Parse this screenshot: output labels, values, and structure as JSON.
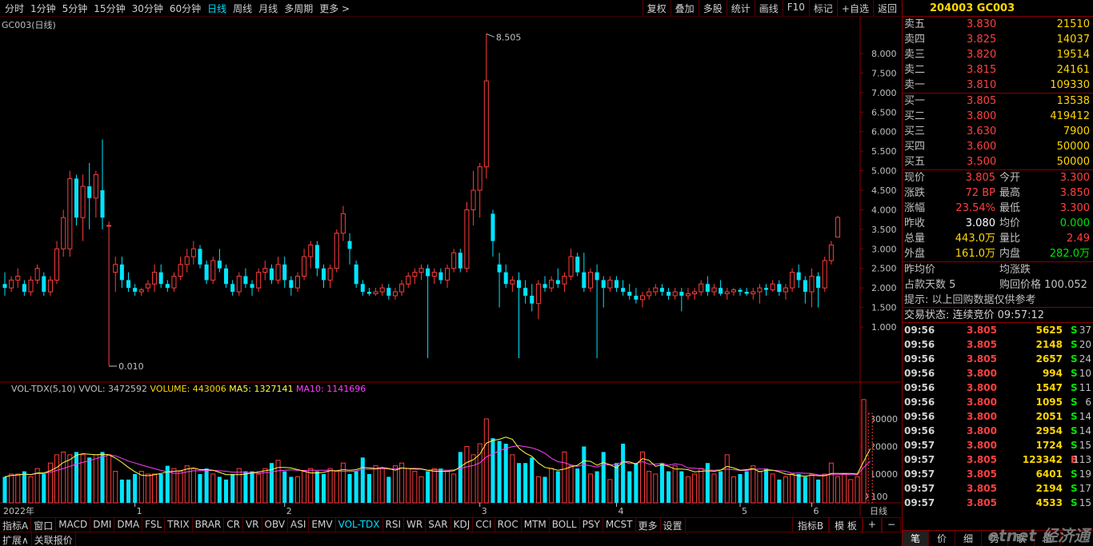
{
  "topbar": {
    "periods": [
      "分时",
      "1分钟",
      "5分钟",
      "15分钟",
      "30分钟",
      "60分钟",
      "日线",
      "周线",
      "月线",
      "多周期",
      "更多 >"
    ],
    "active_period": "日线",
    "tools": [
      "复权",
      "叠加",
      "多股",
      "统计",
      "画线",
      "F10",
      "标记",
      "+自选",
      "返回"
    ]
  },
  "main_pane": {
    "title": "GC003(日线)",
    "y_ticks": [
      "8.000",
      "7.500",
      "7.000",
      "6.500",
      "6.000",
      "5.500",
      "5.000",
      "4.500",
      "4.000",
      "3.500",
      "3.000",
      "2.500",
      "2.000",
      "1.500",
      "1.000"
    ],
    "high_label": "8.505",
    "low_label": "0.010"
  },
  "vol_pane": {
    "legend_name": "VOL-TDX(5,10)",
    "legend_vvol": "VVOL: 3472592",
    "legend_volume": "VOLUME: 443006",
    "legend_ma5": "MA5: 1327141",
    "legend_ma10": "MA10: 1141696",
    "y_ticks": [
      "30000",
      "20000",
      "10000"
    ],
    "unit": "X100"
  },
  "x_axis": {
    "labels": [
      "2022年",
      "1",
      "2",
      "3",
      "4",
      "5",
      "6"
    ],
    "right_label": "日线"
  },
  "indicator_bar": {
    "items": [
      "指标A",
      "窗口",
      "MACD",
      "DMI",
      "DMA",
      "FSL",
      "TRIX",
      "BRAR",
      "CR",
      "VR",
      "OBV",
      "ASI",
      "EMV",
      "VOL-TDX",
      "RSI",
      "WR",
      "SAR",
      "KDJ",
      "CCI",
      "ROC",
      "MTM",
      "BOLL",
      "PSY",
      "MCST",
      "更多",
      "设置"
    ],
    "active": "VOL-TDX",
    "right_items": [
      "指标B",
      "模 板",
      "+",
      "−"
    ]
  },
  "bottom_bar": {
    "items": [
      "扩展∧",
      "关联报价"
    ]
  },
  "quote_panel": {
    "title": "204003 GC003",
    "sells": [
      {
        "label": "卖五",
        "price": "3.830",
        "vol": "21510"
      },
      {
        "label": "卖四",
        "price": "3.825",
        "vol": "14037"
      },
      {
        "label": "卖三",
        "price": "3.820",
        "vol": "19514"
      },
      {
        "label": "卖二",
        "price": "3.815",
        "vol": "24161"
      },
      {
        "label": "卖一",
        "price": "3.810",
        "vol": "109330"
      }
    ],
    "buys": [
      {
        "label": "买一",
        "price": "3.805",
        "vol": "13538"
      },
      {
        "label": "买二",
        "price": "3.800",
        "vol": "419412"
      },
      {
        "label": "买三",
        "price": "3.630",
        "vol": "7900"
      },
      {
        "label": "买四",
        "price": "3.600",
        "vol": "50000"
      },
      {
        "label": "买五",
        "price": "3.500",
        "vol": "50000"
      }
    ],
    "stats": [
      {
        "l1": "现价",
        "v1": "3.805",
        "c1": "red",
        "l2": "今开",
        "v2": "3.300",
        "c2": "red"
      },
      {
        "l1": "涨跌",
        "v1": "72 BP",
        "c1": "red",
        "l2": "最高",
        "v2": "3.850",
        "c2": "red"
      },
      {
        "l1": "涨幅",
        "v1": "23.54%",
        "c1": "red",
        "l2": "最低",
        "v2": "3.300",
        "c2": "red"
      },
      {
        "l1": "昨收",
        "v1": "3.080",
        "c1": "white",
        "l2": "均价",
        "v2": "0.000",
        "c2": "green"
      },
      {
        "l1": "总量",
        "v1": "443.0万",
        "c1": "yellow",
        "l2": "量比",
        "v2": "2.49",
        "c2": "red"
      },
      {
        "l1": "外盘",
        "v1": "161.0万",
        "c1": "yellow",
        "l2": "内盘",
        "v2": "282.0万",
        "c2": "green"
      }
    ],
    "info": {
      "prev_avg_label": "昨均价",
      "avg_change_label": "均涨跌",
      "days_label": "占款天数 5",
      "repo_label": "购回价格 100.052",
      "hint": "提示: 以上回购数据仅供参考",
      "status": "交易状态: 连续竞价 09:57:12"
    },
    "ticks": [
      {
        "t": "09:56",
        "p": "3.805",
        "v": "5625",
        "s": "S",
        "n": "37"
      },
      {
        "t": "09:56",
        "p": "3.805",
        "v": "2148",
        "s": "S",
        "n": "20"
      },
      {
        "t": "09:56",
        "p": "3.805",
        "v": "2657",
        "s": "S",
        "n": "24"
      },
      {
        "t": "09:56",
        "p": "3.800",
        "v": "994",
        "s": "S",
        "n": "10"
      },
      {
        "t": "09:56",
        "p": "3.800",
        "v": "1547",
        "s": "S",
        "n": "11"
      },
      {
        "t": "09:56",
        "p": "3.800",
        "v": "1095",
        "s": "S",
        "n": "6"
      },
      {
        "t": "09:56",
        "p": "3.800",
        "v": "2051",
        "s": "S",
        "n": "14"
      },
      {
        "t": "09:56",
        "p": "3.800",
        "v": "2954",
        "s": "S",
        "n": "14"
      },
      {
        "t": "09:57",
        "p": "3.800",
        "v": "1724",
        "s": "S",
        "n": "15"
      },
      {
        "t": "09:57",
        "p": "3.805",
        "v": "123342",
        "s": "B",
        "n": "113"
      },
      {
        "t": "09:57",
        "p": "3.805",
        "v": "6401",
        "s": "S",
        "n": "19"
      },
      {
        "t": "09:57",
        "p": "3.805",
        "v": "2194",
        "s": "S",
        "n": "17"
      },
      {
        "t": "09:57",
        "p": "3.805",
        "v": "4533",
        "s": "S",
        "n": "15"
      }
    ],
    "tabs": [
      "笔",
      "价",
      "细",
      "势",
      "联",
      "值"
    ],
    "active_tab": "笔",
    "watermark": "etnet 经济通"
  },
  "colors": {
    "up": "#ff3c3c",
    "down": "#00e5ff",
    "ma5": "#ffff40",
    "ma10": "#ff40ff",
    "grid": "#8a0000"
  },
  "chart_data": {
    "type": "candlestick",
    "title": "GC003(日线)",
    "ylim": [
      0,
      9
    ],
    "x_months": [
      "2022年",
      "1",
      "2",
      "3",
      "4",
      "5",
      "6"
    ],
    "notes": "Approximate daily OHLC values read from chart; last close 3.805",
    "ohlc": [
      [
        2.1,
        2.4,
        1.8,
        2.0
      ],
      [
        2.0,
        2.3,
        1.9,
        2.2
      ],
      [
        2.2,
        2.5,
        2.0,
        2.3
      ],
      [
        2.1,
        2.2,
        1.8,
        1.9
      ],
      [
        1.9,
        2.3,
        1.8,
        2.2
      ],
      [
        2.2,
        2.6,
        2.1,
        2.5
      ],
      [
        2.3,
        2.4,
        1.8,
        1.9
      ],
      [
        1.9,
        2.3,
        1.8,
        2.2
      ],
      [
        2.2,
        3.2,
        2.1,
        3.0
      ],
      [
        3.0,
        4.0,
        2.8,
        3.8
      ],
      [
        3.0,
        5.0,
        2.8,
        4.8
      ],
      [
        4.8,
        4.9,
        3.6,
        3.8
      ],
      [
        3.8,
        4.9,
        3.2,
        4.6
      ],
      [
        4.6,
        5.2,
        3.5,
        4.3
      ],
      [
        4.3,
        5.0,
        3.8,
        4.9
      ],
      [
        4.5,
        5.8,
        3.5,
        3.8
      ],
      [
        3.6,
        3.7,
        0.01,
        3.6
      ],
      [
        2.4,
        2.8,
        1.9,
        2.6
      ],
      [
        2.6,
        2.8,
        2.0,
        2.2
      ],
      [
        2.2,
        2.4,
        1.9,
        2.0
      ],
      [
        2.0,
        2.1,
        1.8,
        1.9
      ],
      [
        1.9,
        2.0,
        1.8,
        1.95
      ],
      [
        2.0,
        2.2,
        1.9,
        2.1
      ],
      [
        2.1,
        2.6,
        1.9,
        2.4
      ],
      [
        2.4,
        2.6,
        2.0,
        2.1
      ],
      [
        2.1,
        2.2,
        1.9,
        2.0
      ],
      [
        2.0,
        2.4,
        1.9,
        2.3
      ],
      [
        2.3,
        2.8,
        2.2,
        2.6
      ],
      [
        2.6,
        3.0,
        2.4,
        2.8
      ],
      [
        2.8,
        3.2,
        2.6,
        3.0
      ],
      [
        3.0,
        3.1,
        2.5,
        2.6
      ],
      [
        2.6,
        2.7,
        2.1,
        2.2
      ],
      [
        2.2,
        2.8,
        2.1,
        2.7
      ],
      [
        2.7,
        3.0,
        2.4,
        2.5
      ],
      [
        2.5,
        2.6,
        2.0,
        2.1
      ],
      [
        2.1,
        2.2,
        1.8,
        1.9
      ],
      [
        1.9,
        2.4,
        1.8,
        2.3
      ],
      [
        2.3,
        2.5,
        2.0,
        2.1
      ],
      [
        2.1,
        2.2,
        1.8,
        2.0
      ],
      [
        2.0,
        2.5,
        1.9,
        2.4
      ],
      [
        2.4,
        2.7,
        2.2,
        2.5
      ],
      [
        2.5,
        2.6,
        2.1,
        2.2
      ],
      [
        2.2,
        2.8,
        2.1,
        2.6
      ],
      [
        2.6,
        2.8,
        2.0,
        2.2
      ],
      [
        2.2,
        2.3,
        1.8,
        2.0
      ],
      [
        2.0,
        2.4,
        1.9,
        2.3
      ],
      [
        2.3,
        3.0,
        2.2,
        2.8
      ],
      [
        2.8,
        3.2,
        2.5,
        3.1
      ],
      [
        3.1,
        3.2,
        2.3,
        2.5
      ],
      [
        2.5,
        2.6,
        2.0,
        2.2
      ],
      [
        2.2,
        2.6,
        2.0,
        2.5
      ],
      [
        2.5,
        3.5,
        2.4,
        3.4
      ],
      [
        3.4,
        4.1,
        3.2,
        3.9
      ],
      [
        3.2,
        3.4,
        2.6,
        3.0
      ],
      [
        2.6,
        2.7,
        2.0,
        2.1
      ],
      [
        2.1,
        2.2,
        1.8,
        1.9
      ],
      [
        1.9,
        2.0,
        1.8,
        1.85
      ],
      [
        1.85,
        2.0,
        1.8,
        1.9
      ],
      [
        1.9,
        2.1,
        1.8,
        2.0
      ],
      [
        2.0,
        2.1,
        1.7,
        1.8
      ],
      [
        1.8,
        2.0,
        1.7,
        1.9
      ],
      [
        1.9,
        2.2,
        1.8,
        2.1
      ],
      [
        2.1,
        2.4,
        2.0,
        2.3
      ],
      [
        2.3,
        2.5,
        2.1,
        2.4
      ],
      [
        2.4,
        2.6,
        2.2,
        2.5
      ],
      [
        2.5,
        2.6,
        0.2,
        2.3
      ],
      [
        2.3,
        2.5,
        2.1,
        2.4
      ],
      [
        2.4,
        2.5,
        2.1,
        2.2
      ],
      [
        2.2,
        2.6,
        2.0,
        2.5
      ],
      [
        2.5,
        3.0,
        2.4,
        2.9
      ],
      [
        2.9,
        3.0,
        2.4,
        2.5
      ],
      [
        2.5,
        4.2,
        2.4,
        4.0
      ],
      [
        4.0,
        5.0,
        3.6,
        4.5
      ],
      [
        4.5,
        5.2,
        3.8,
        5.1
      ],
      [
        5.1,
        8.505,
        4.8,
        7.3
      ],
      [
        3.9,
        4.0,
        2.8,
        3.2
      ],
      [
        2.6,
        2.9,
        1.5,
        2.4
      ],
      [
        2.4,
        2.6,
        2.0,
        2.1
      ],
      [
        2.1,
        2.3,
        1.9,
        2.2
      ],
      [
        2.2,
        2.4,
        0.2,
        2.0
      ],
      [
        2.0,
        2.2,
        1.6,
        1.8
      ],
      [
        1.8,
        2.1,
        1.4,
        1.6
      ],
      [
        1.6,
        2.2,
        1.2,
        2.1
      ],
      [
        2.1,
        2.3,
        1.9,
        2.0
      ],
      [
        2.0,
        2.3,
        1.9,
        2.2
      ],
      [
        2.2,
        2.5,
        2.0,
        2.1
      ],
      [
        2.1,
        2.4,
        1.9,
        2.3
      ],
      [
        2.3,
        3.0,
        2.2,
        2.8
      ],
      [
        2.8,
        2.9,
        2.3,
        2.4
      ],
      [
        2.4,
        2.9,
        1.9,
        2.0
      ],
      [
        2.0,
        2.5,
        1.9,
        2.4
      ],
      [
        2.4,
        2.6,
        0.2,
        2.2
      ],
      [
        2.2,
        2.3,
        1.5,
        2.0
      ],
      [
        2.0,
        2.3,
        1.9,
        2.2
      ],
      [
        2.2,
        2.3,
        1.9,
        2.0
      ],
      [
        2.0,
        2.2,
        1.8,
        1.9
      ],
      [
        1.9,
        2.1,
        1.7,
        1.8
      ],
      [
        1.8,
        2.0,
        1.6,
        1.7
      ],
      [
        1.7,
        1.9,
        1.5,
        1.8
      ],
      [
        1.8,
        2.0,
        1.7,
        1.9
      ],
      [
        1.9,
        2.1,
        1.8,
        2.0
      ],
      [
        2.0,
        2.1,
        1.8,
        1.9
      ],
      [
        1.9,
        2.0,
        1.7,
        1.8
      ],
      [
        1.8,
        2.0,
        1.7,
        1.9
      ],
      [
        1.9,
        2.0,
        1.4,
        1.8
      ],
      [
        1.8,
        2.0,
        1.7,
        1.85
      ],
      [
        1.85,
        2.0,
        1.7,
        1.9
      ],
      [
        1.9,
        2.2,
        1.8,
        2.1
      ],
      [
        2.1,
        2.3,
        1.8,
        1.9
      ],
      [
        1.9,
        2.1,
        1.8,
        2.0
      ],
      [
        2.0,
        2.2,
        1.8,
        1.85
      ],
      [
        1.85,
        2.0,
        1.7,
        1.9
      ],
      [
        1.9,
        2.0,
        1.8,
        1.95
      ],
      [
        1.95,
        2.0,
        1.8,
        1.9
      ],
      [
        1.9,
        2.0,
        1.8,
        1.85
      ],
      [
        1.85,
        2.0,
        1.7,
        1.9
      ],
      [
        1.9,
        2.1,
        1.6,
        2.0
      ],
      [
        2.0,
        2.1,
        1.8,
        1.95
      ],
      [
        1.95,
        2.2,
        1.9,
        2.1
      ],
      [
        2.1,
        2.2,
        1.8,
        1.9
      ],
      [
        1.9,
        2.1,
        1.7,
        2.0
      ],
      [
        2.0,
        2.5,
        1.9,
        2.4
      ],
      [
        2.4,
        2.6,
        2.0,
        2.2
      ],
      [
        2.2,
        2.3,
        1.6,
        1.9
      ],
      [
        1.9,
        2.5,
        1.5,
        2.3
      ],
      [
        2.3,
        2.4,
        1.5,
        2.0
      ],
      [
        2.0,
        2.8,
        1.9,
        2.7
      ],
      [
        2.7,
        3.2,
        2.6,
        3.1
      ],
      [
        3.3,
        3.85,
        3.3,
        3.805
      ]
    ],
    "volume": [
      9,
      10,
      10,
      11,
      9,
      12,
      10,
      14,
      17,
      18,
      17,
      18,
      17,
      16,
      17,
      18,
      17,
      11,
      8,
      8,
      10,
      11,
      10,
      10,
      10,
      13,
      12,
      11,
      13,
      12,
      10,
      12,
      10,
      9,
      8,
      10,
      12,
      11,
      11,
      10,
      12,
      14,
      15,
      11,
      9,
      9,
      11,
      12,
      11,
      10,
      12,
      11,
      14,
      10,
      11,
      16,
      10,
      13,
      12,
      9,
      13,
      14,
      12,
      11,
      9,
      11,
      12,
      12,
      11,
      10,
      18,
      20,
      17,
      21,
      30,
      23,
      22,
      21,
      17,
      14,
      14,
      16,
      9,
      9,
      12,
      11,
      18,
      13,
      12,
      20,
      10,
      11,
      18,
      8,
      14,
      21,
      11,
      14,
      18,
      11,
      10,
      14,
      11,
      13,
      11,
      9,
      10,
      12,
      14,
      10,
      11,
      17,
      9,
      10,
      11,
      13,
      11,
      12,
      10,
      8,
      9,
      10,
      10,
      9,
      10,
      8,
      10,
      14,
      9,
      10,
      8,
      9,
      37,
      32
    ]
  }
}
